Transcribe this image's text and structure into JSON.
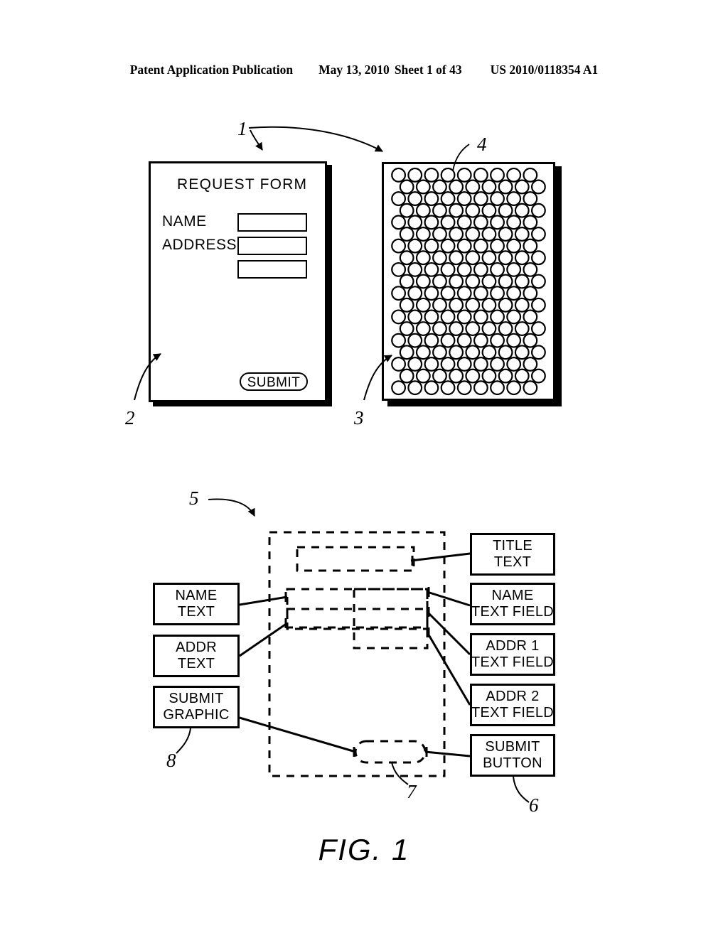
{
  "header": {
    "publication": "Patent Application Publication",
    "date": "May 13, 2010",
    "sheet": "Sheet 1 of 43",
    "docnumber": "US 2010/0118354 A1"
  },
  "figure": {
    "caption": "FIG. 1"
  },
  "form_page": {
    "title": "REQUEST FORM",
    "labels": [
      "NAME",
      "ADDRESS"
    ],
    "fields": [
      "",
      "",
      ""
    ],
    "submit_label": "SUBMIT"
  },
  "coded_page": {
    "pattern": "dot-pattern-grid",
    "columns": 10,
    "rows": 19,
    "dot_shape": "circle"
  },
  "block_diagram": {
    "left_blocks": [
      {
        "lines": [
          "NAME",
          "TEXT"
        ]
      },
      {
        "lines": [
          "ADDR",
          "TEXT"
        ]
      },
      {
        "lines": [
          "SUBMIT",
          "GRAPHIC"
        ]
      }
    ],
    "right_blocks": [
      {
        "lines": [
          "TITLE",
          "TEXT"
        ]
      },
      {
        "lines": [
          "NAME",
          "TEXT FIELD"
        ]
      },
      {
        "lines": [
          "ADDR 1",
          "TEXT FIELD"
        ]
      },
      {
        "lines": [
          "ADDR 2",
          "TEXT FIELD"
        ]
      },
      {
        "lines": [
          "SUBMIT",
          "BUTTON"
        ]
      }
    ]
  },
  "reference_numerals": {
    "n1": "1",
    "n2": "2",
    "n3": "3",
    "n4": "4",
    "n5": "5",
    "n6": "6",
    "n7": "7",
    "n8": "8"
  },
  "colors": {
    "ink": "#000000",
    "paper": "#ffffff"
  }
}
